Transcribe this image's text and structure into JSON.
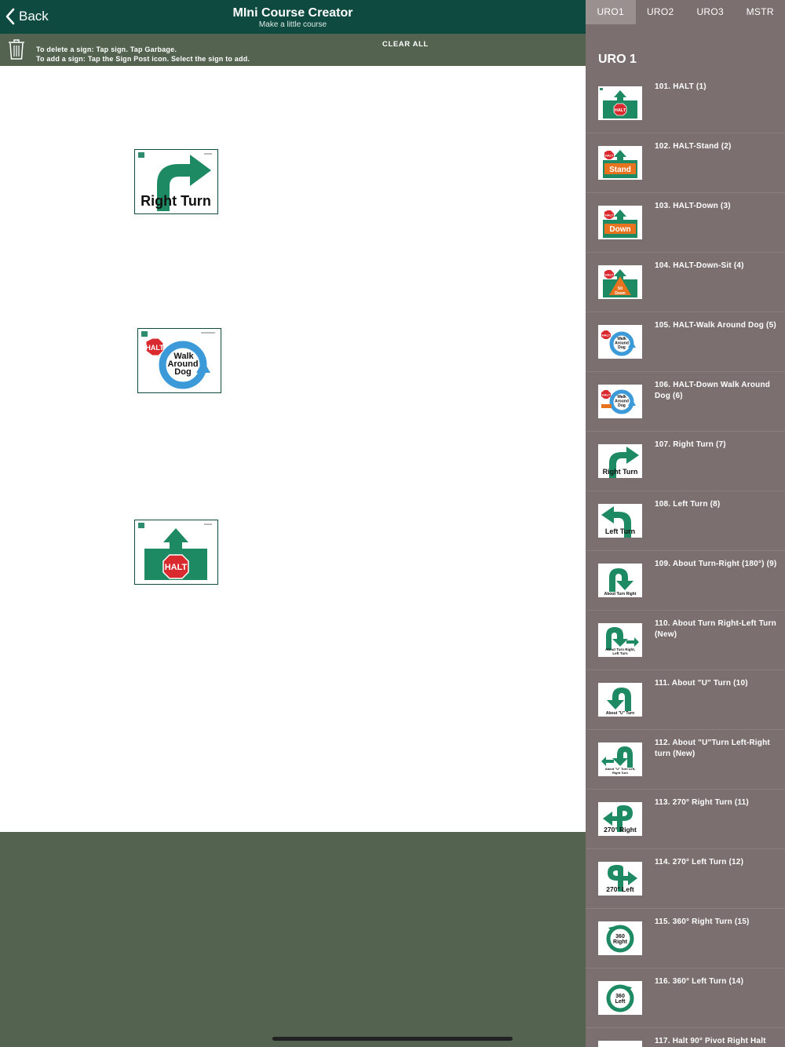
{
  "header": {
    "back_label": "Back",
    "title": "MIni Course Creator",
    "subtitle": "Make a little course"
  },
  "toolbar": {
    "hint_delete": "To delete a sign: Tap sign. Tap Garbage.",
    "hint_add": "To add a sign: Tap the Sign Post icon. Select the sign to add.",
    "clear_all_label": "CLEAR ALL"
  },
  "canvas": {
    "placed_signs": [
      {
        "text": "Right Turn"
      },
      {
        "text": "HALT Walk Around Dog"
      },
      {
        "text": "HALT"
      }
    ]
  },
  "sidebar": {
    "tabs": [
      {
        "label": "URO1",
        "active": true
      },
      {
        "label": "URO2",
        "active": false
      },
      {
        "label": "URO3",
        "active": false
      },
      {
        "label": "MSTR",
        "active": false
      }
    ],
    "heading": "URO 1",
    "signs": [
      {
        "label": "101. HALT (1)",
        "icon": "halt"
      },
      {
        "label": "102. HALT-Stand (2)",
        "icon": "halt-stand"
      },
      {
        "label": "103. HALT-Down (3)",
        "icon": "halt-down"
      },
      {
        "label": "104. HALT-Down-Sit (4)",
        "icon": "halt-down-sit"
      },
      {
        "label": "105. HALT-Walk Around Dog (5)",
        "icon": "walk-around"
      },
      {
        "label": "106. HALT-Down Walk Around Dog (6)",
        "icon": "down-walk-around"
      },
      {
        "label": "107. Right Turn (7)",
        "icon": "right-turn"
      },
      {
        "label": "108. Left Turn (8)",
        "icon": "left-turn"
      },
      {
        "label": "109. About Turn-Right (180°) (9)",
        "icon": "about-turn"
      },
      {
        "label": "110. About Turn Right-Left Turn (New)",
        "icon": "about-turn-left"
      },
      {
        "label": "111. About \"U\" Turn (10)",
        "icon": "u-turn"
      },
      {
        "label": "112. About \"U\"Turn Left-Right turn (New)",
        "icon": "u-turn-right"
      },
      {
        "label": "113. 270° Right Turn (11)",
        "icon": "270-right"
      },
      {
        "label": "114. 270° Left Turn (12)",
        "icon": "270-left"
      },
      {
        "label": "115. 360° Right Turn (15)",
        "icon": "360-right"
      },
      {
        "label": "116. 360° Left Turn (14)",
        "icon": "360-left"
      },
      {
        "label": "117. Halt 90° Pivot Right Halt",
        "icon": "pivot-right"
      }
    ]
  },
  "thumb_texts": {
    "halt": "HALT",
    "stand": "Stand",
    "down": "Down",
    "sit_down": "Sit Down",
    "walk": "Walk Around Dog",
    "right_turn": "Right Turn",
    "left_turn": "Left Turn",
    "about_turn_right": "About Turn Right",
    "about_turn_left": "About Turn Right, Left Turn",
    "about_u": "About \"U\" Turn",
    "about_u_lr": "About \"U\" Turn Left, Right Turn",
    "r270": "270° Right",
    "l270": "270° Left",
    "r360": "360 Right",
    "l360": "360 Left"
  },
  "colors": {
    "brand_green": "#1d8a63",
    "halt_red": "#d92b2f",
    "orange": "#e8731e",
    "blue": "#3c9ad8",
    "header_bg": "#0f4a40",
    "panel_bg": "#7b6f6f"
  }
}
